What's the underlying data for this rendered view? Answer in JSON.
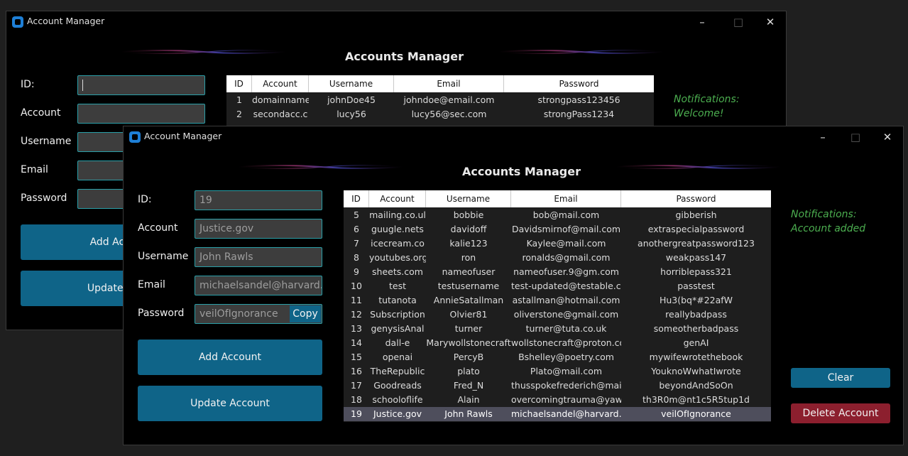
{
  "back_window": {
    "title": "Account Manager",
    "heading": "Accounts Manager",
    "labels": [
      "ID:",
      "Account",
      "Username",
      "Email",
      "Password"
    ],
    "add_button": "Add Acco",
    "update_button": "Update Ac",
    "table": {
      "headers": [
        "ID",
        "Account",
        "Username",
        "Email",
        "Password"
      ],
      "rows": [
        [
          "1",
          "domainname",
          "johnDoe45",
          "johndoe@email.com",
          "strongpass123456"
        ],
        [
          "2",
          "secondacc.c",
          "lucy56",
          "lucy56@sec.com",
          "strongPass1234"
        ]
      ]
    },
    "notification_label": "Notifications:",
    "notification_text": "Welcome!"
  },
  "front_window": {
    "title": "Account Manager",
    "heading": "Accounts Manager",
    "form": {
      "id_label": "ID:",
      "id_value": "19",
      "account_label": "Account",
      "account_value": "Justice.gov",
      "username_label": "Username",
      "username_value": "John Rawls",
      "email_label": "Email",
      "email_value": "michaelsandel@harvard.ec",
      "password_label": "Password",
      "password_value": "veilOfIgnorance",
      "copy_label": "Copy"
    },
    "add_button": "Add Account",
    "update_button": "Update Account",
    "table": {
      "headers": [
        "ID",
        "Account",
        "Username",
        "Email",
        "Password"
      ],
      "rows": [
        [
          "5",
          "mailing.co.ul",
          "bobbie",
          "bob@mail.com",
          "gibberish"
        ],
        [
          "6",
          "guugle.nets",
          "davidoff",
          "Davidsmirnof@mail.com",
          "extraspecialpassword"
        ],
        [
          "7",
          "icecream.co",
          "kalie123",
          "Kaylee@mail.com",
          "anothergreatpassword123"
        ],
        [
          "8",
          "youtubes.org",
          "ron",
          "ronalds@gmail.com",
          "weakpass147"
        ],
        [
          "9",
          "sheets.com",
          "nameofuser",
          "nameofuser.9@gm.com",
          "horriblepass321"
        ],
        [
          "10",
          "test",
          "testusername",
          "test-updated@testable.cc",
          "passtest"
        ],
        [
          "11",
          "tutanota",
          "AnnieSatallman",
          "astallman@hotmail.com",
          "Hu3(bq*#22afW"
        ],
        [
          "12",
          "Subscription",
          "Olvier81",
          "oliverstone@gmail.com",
          "reallybadpass"
        ],
        [
          "13",
          "genysisAnal",
          "turner",
          "turner@tuta.co.uk",
          "someotherbadpass"
        ],
        [
          "14",
          "dall-e",
          "Marywollstonecraft",
          "wollstonecraft@proton.co",
          "genAI"
        ],
        [
          "15",
          "openai",
          "PercyB",
          "Bshelley@poetry.com",
          "mywifewrotethebook"
        ],
        [
          "16",
          "TheRepublic",
          "plato",
          "Plato@mail.com",
          "YouknoWwhatIwrote"
        ],
        [
          "17",
          "Goodreads",
          "Fred_N",
          "thusspokefrederich@mail",
          "beyondAndSoOn"
        ],
        [
          "18",
          "schooloflife",
          "Alain",
          "overcomingtrauma@yawh",
          "th3R0m@nt1c5R5tup1d"
        ],
        [
          "19",
          "Justice.gov",
          "John Rawls",
          "michaelsandel@harvard.e",
          "veilOfIgnorance"
        ]
      ],
      "selected_id": "19"
    },
    "notification_label": "Notifications:",
    "notification_text": "Account added",
    "clear_button": "Clear",
    "delete_button": "Delete Account"
  },
  "colors": {
    "accent": "#0f6488",
    "delete": "#8c1f2e",
    "notification": "#4caf50",
    "input_border": "#2a9fa8"
  },
  "icons": [
    "app-icon",
    "minimize-icon",
    "maximize-icon",
    "close-icon"
  ]
}
